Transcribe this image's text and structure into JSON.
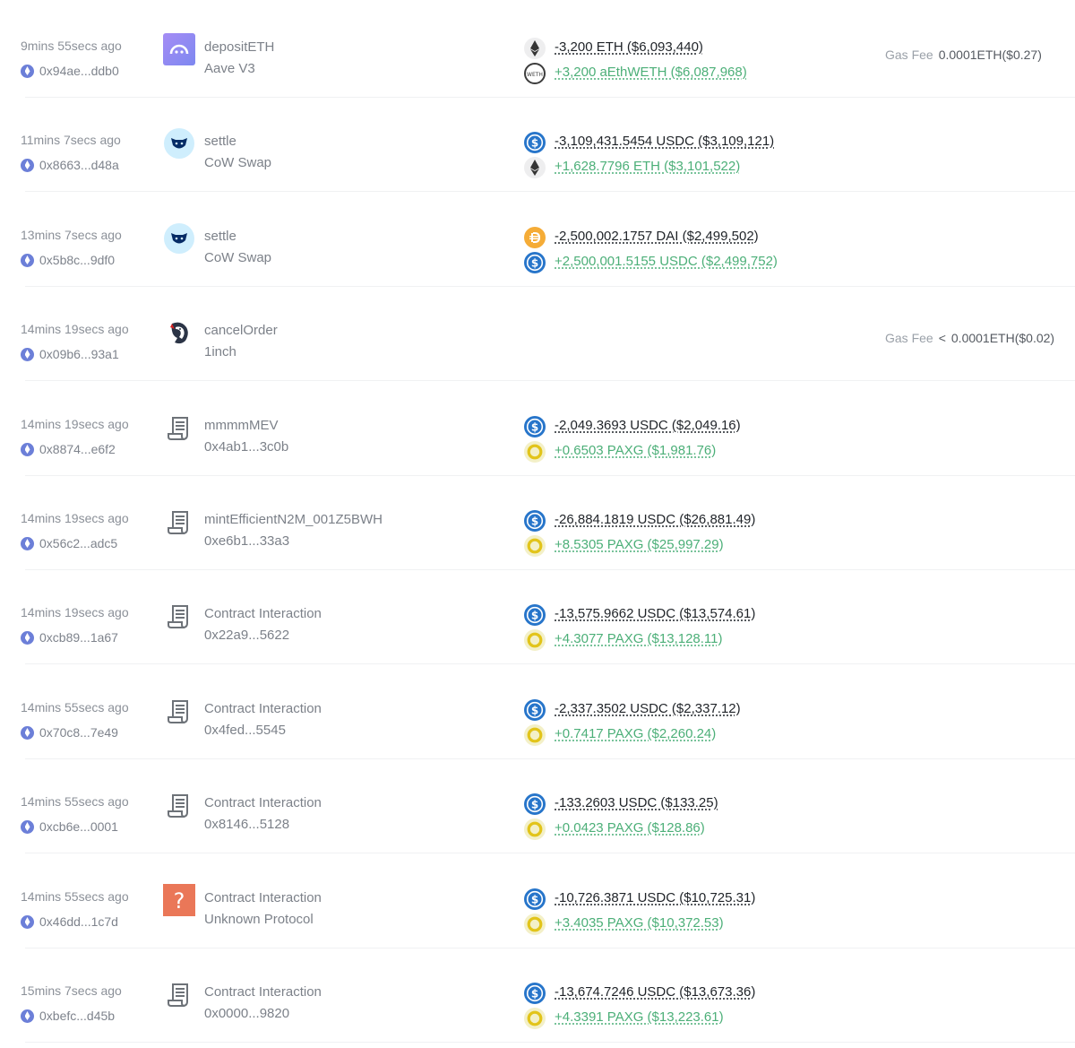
{
  "colors": {
    "positive": "#4caf78",
    "negative": "#1f2328",
    "muted": "#8b9098",
    "eth_badge": "#6c7fd8"
  },
  "transactions": [
    {
      "time": "9mins 55secs ago",
      "from": "0x94ae...ddb0",
      "method": "depositETH",
      "protocol": "Aave V3",
      "protocol_icon": "aave-icon",
      "transfers": [
        {
          "token_icon": "eth",
          "amount": "-3,200 ETH ($6,093,440)",
          "direction": "out"
        },
        {
          "token_icon": "aweth",
          "amount": "+3,200 aEthWETH ($6,087,968)",
          "direction": "in"
        }
      ],
      "fee": {
        "label": "Gas Fee",
        "prefix": "",
        "value": "0.0001ETH($0.27)"
      }
    },
    {
      "time": "11mins 7secs ago",
      "from": "0x8663...d48a",
      "method": "settle",
      "protocol": "CoW Swap",
      "protocol_icon": "cow-icon",
      "transfers": [
        {
          "token_icon": "usdc",
          "amount": "-3,109,431.5454 USDC ($3,109,121)",
          "direction": "out"
        },
        {
          "token_icon": "eth",
          "amount": "+1,628.7796 ETH ($3,101,522)",
          "direction": "in"
        }
      ]
    },
    {
      "time": "13mins 7secs ago",
      "from": "0x5b8c...9df0",
      "method": "settle",
      "protocol": "CoW Swap",
      "protocol_icon": "cow-icon",
      "transfers": [
        {
          "token_icon": "dai",
          "amount": "-2,500,002.1757 DAI ($2,499,502)",
          "direction": "out"
        },
        {
          "token_icon": "usdc",
          "amount": "+2,500,001.5155 USDC ($2,499,752)",
          "direction": "in"
        }
      ]
    },
    {
      "time": "14mins 19secs ago",
      "from": "0x09b6...93a1",
      "method": "cancelOrder",
      "protocol": "1inch",
      "protocol_icon": "oneinch-icon",
      "transfers": [],
      "fee": {
        "label": "Gas Fee",
        "prefix": "<",
        "value": "0.0001ETH($0.02)"
      }
    },
    {
      "time": "14mins 19secs ago",
      "from": "0x8874...e6f2",
      "method": "mmmmMEV",
      "protocol": "0x4ab1...3c0b",
      "protocol_icon": "contract-icon",
      "transfers": [
        {
          "token_icon": "usdc",
          "amount": "-2,049.3693 USDC ($2,049.16)",
          "direction": "out"
        },
        {
          "token_icon": "paxg",
          "amount": "+0.6503 PAXG ($1,981.76)",
          "direction": "in"
        }
      ]
    },
    {
      "time": "14mins 19secs ago",
      "from": "0x56c2...adc5",
      "method": "mintEfficientN2M_001Z5BWH",
      "protocol": "0xe6b1...33a3",
      "protocol_icon": "contract-icon",
      "transfers": [
        {
          "token_icon": "usdc",
          "amount": "-26,884.1819 USDC ($26,881.49)",
          "direction": "out"
        },
        {
          "token_icon": "paxg",
          "amount": "+8.5305 PAXG ($25,997.29)",
          "direction": "in"
        }
      ]
    },
    {
      "time": "14mins 19secs ago",
      "from": "0xcb89...1a67",
      "method": "Contract Interaction",
      "protocol": "0x22a9...5622",
      "protocol_icon": "contract-icon",
      "transfers": [
        {
          "token_icon": "usdc",
          "amount": "-13,575.9662 USDC ($13,574.61)",
          "direction": "out"
        },
        {
          "token_icon": "paxg",
          "amount": "+4.3077 PAXG ($13,128.11)",
          "direction": "in"
        }
      ]
    },
    {
      "time": "14mins 55secs ago",
      "from": "0x70c8...7e49",
      "method": "Contract Interaction",
      "protocol": "0x4fed...5545",
      "protocol_icon": "contract-icon",
      "transfers": [
        {
          "token_icon": "usdc",
          "amount": "-2,337.3502 USDC ($2,337.12)",
          "direction": "out"
        },
        {
          "token_icon": "paxg",
          "amount": "+0.7417 PAXG ($2,260.24)",
          "direction": "in"
        }
      ]
    },
    {
      "time": "14mins 55secs ago",
      "from": "0xcb6e...0001",
      "method": "Contract Interaction",
      "protocol": "0x8146...5128",
      "protocol_icon": "contract-icon",
      "transfers": [
        {
          "token_icon": "usdc",
          "amount": "-133.2603 USDC ($133.25)",
          "direction": "out"
        },
        {
          "token_icon": "paxg",
          "amount": "+0.0423 PAXG ($128.86)",
          "direction": "in"
        }
      ]
    },
    {
      "time": "14mins 55secs ago",
      "from": "0x46dd...1c7d",
      "method": "Contract Interaction",
      "protocol": "Unknown Protocol",
      "protocol_icon": "unknown-protocol-icon",
      "transfers": [
        {
          "token_icon": "usdc",
          "amount": "-10,726.3871 USDC ($10,725.31)",
          "direction": "out"
        },
        {
          "token_icon": "paxg",
          "amount": "+3.4035 PAXG ($10,372.53)",
          "direction": "in"
        }
      ]
    },
    {
      "time": "15mins 7secs ago",
      "from": "0xbefc...d45b",
      "method": "Contract Interaction",
      "protocol": "0x0000...9820",
      "protocol_icon": "contract-icon",
      "transfers": [
        {
          "token_icon": "usdc",
          "amount": "-13,674.7246 USDC ($13,673.36)",
          "direction": "out"
        },
        {
          "token_icon": "paxg",
          "amount": "+4.3391 PAXG ($13,223.61)",
          "direction": "in"
        }
      ]
    }
  ]
}
